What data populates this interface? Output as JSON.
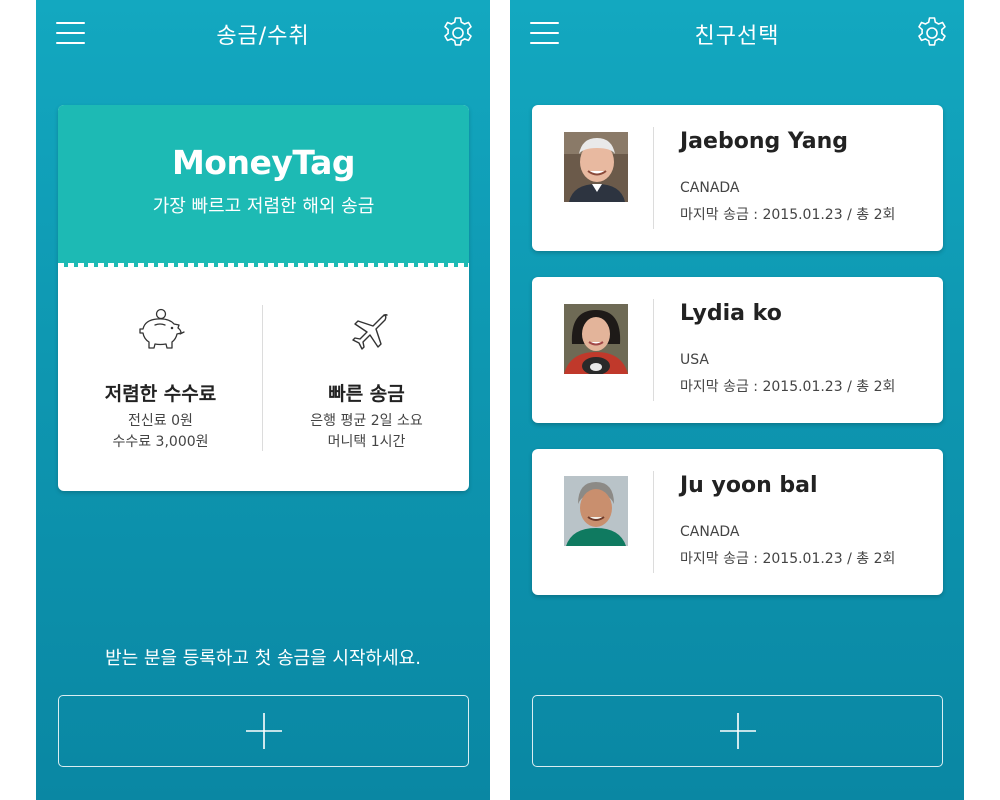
{
  "colors": {
    "background_top": "#13a8c0",
    "background_bottom": "#0a87a3",
    "card_header": "#1dbab4",
    "card": "#ffffff"
  },
  "left_screen": {
    "title": "송금/수취",
    "menu_icon": "hamburger-menu-icon",
    "settings_icon": "gear-icon",
    "card": {
      "logo": "MoneyTag",
      "tagline": "가장 빠르고 저렴한 해외 송금",
      "features": [
        {
          "icon": "piggy-bank-icon",
          "title": "저렴한 수수료",
          "line1": "전신료 0원",
          "line2": "수수료 3,000원"
        },
        {
          "icon": "airplane-icon",
          "title": "빠른 송금",
          "line1": "은행 평균 2일 소요",
          "line2": "머니택 1시간"
        }
      ]
    },
    "prompt": "받는 분을 등록하고 첫 송금을 시작하세요.",
    "add_icon": "plus-icon"
  },
  "right_screen": {
    "title": "친구선택",
    "menu_icon": "hamburger-menu-icon",
    "settings_icon": "gear-icon",
    "friends": [
      {
        "name": "Jaebong Yang",
        "country": "CANADA",
        "last_transfer": "마지막 송금 : 2015.01.23 / 총 2회"
      },
      {
        "name": "Lydia ko",
        "country": "USA",
        "last_transfer": "마지막 송금 : 2015.01.23 / 총 2회"
      },
      {
        "name": "Ju yoon bal",
        "country": "CANADA",
        "last_transfer": "마지막 송금 : 2015.01.23 / 총 2회"
      }
    ],
    "add_icon": "plus-icon"
  }
}
